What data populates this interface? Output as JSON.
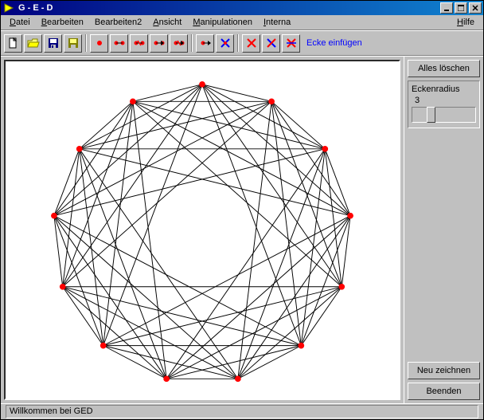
{
  "title": "G - E - D",
  "menu": {
    "datei": "Datei",
    "bearbeiten": "Bearbeiten",
    "bearbeiten2": "Bearbeiten2",
    "ansicht": "Ansicht",
    "manipulationen": "Manipulationen",
    "interna": "Interna",
    "hilfe": "Hilfe"
  },
  "toolbar": {
    "mode_label": "Ecke einfügen"
  },
  "sidepanel": {
    "clear_all": "Alles löschen",
    "radius_label": "Eckenradius",
    "radius_value": "3",
    "redraw": "Neu zeichnen",
    "quit": "Beenden"
  },
  "status": "Willkommen bei GED",
  "graph": {
    "vertex_count": 13,
    "vertex_radius": 3,
    "edges": "complete",
    "skip_distances_drawn": [
      1,
      2,
      3,
      4,
      5
    ]
  },
  "chart_data": {
    "type": "graph",
    "description": "Circulant / near-complete graph on 13 vertices arranged on a circle; vertices connected at chord distances 1–5 (distance 6 omitted, leaving a small empty central region).",
    "n_vertices": 13,
    "vertex_color": "#ff0000",
    "edge_color": "#000000",
    "connections": [
      1,
      2,
      3,
      4,
      5
    ]
  }
}
